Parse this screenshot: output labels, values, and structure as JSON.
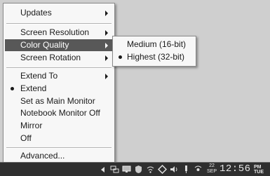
{
  "context_menu": {
    "items": [
      {
        "label": "Updates",
        "submenu": true
      },
      {
        "label": "Screen Resolution",
        "submenu": true
      },
      {
        "label": "Color Quality",
        "submenu": true,
        "highlighted": true
      },
      {
        "label": "Screen Rotation",
        "submenu": true
      },
      {
        "label": "Extend To",
        "submenu": true
      },
      {
        "label": "Extend",
        "selected": true
      },
      {
        "label": "Set as Main Monitor"
      },
      {
        "label": "Notebook Monitor Off"
      },
      {
        "label": "Mirror"
      },
      {
        "label": "Off"
      },
      {
        "label": "Advanced..."
      }
    ]
  },
  "color_quality_submenu": {
    "items": [
      {
        "label": "Medium (16-bit)",
        "selected": false
      },
      {
        "label": "Highest (32-bit)",
        "selected": true
      }
    ]
  },
  "taskbar": {
    "date_day": "22",
    "date_month": "SEP",
    "time": "12:56",
    "weekday_top": "PM",
    "weekday_bottom": "TUE",
    "tray_icons": [
      "chevron-left-icon",
      "network-icon",
      "display-icon",
      "shield-icon",
      "wireless-icon",
      "diamond-icon",
      "volume-icon",
      "pin-icon",
      "antenna-icon"
    ]
  },
  "colors": {
    "menu_bg": "#f7f7f7",
    "highlight_bg": "#585858",
    "taskbar_bg": "#2f2f2f",
    "desktop_bg": "#cfcfcf"
  }
}
